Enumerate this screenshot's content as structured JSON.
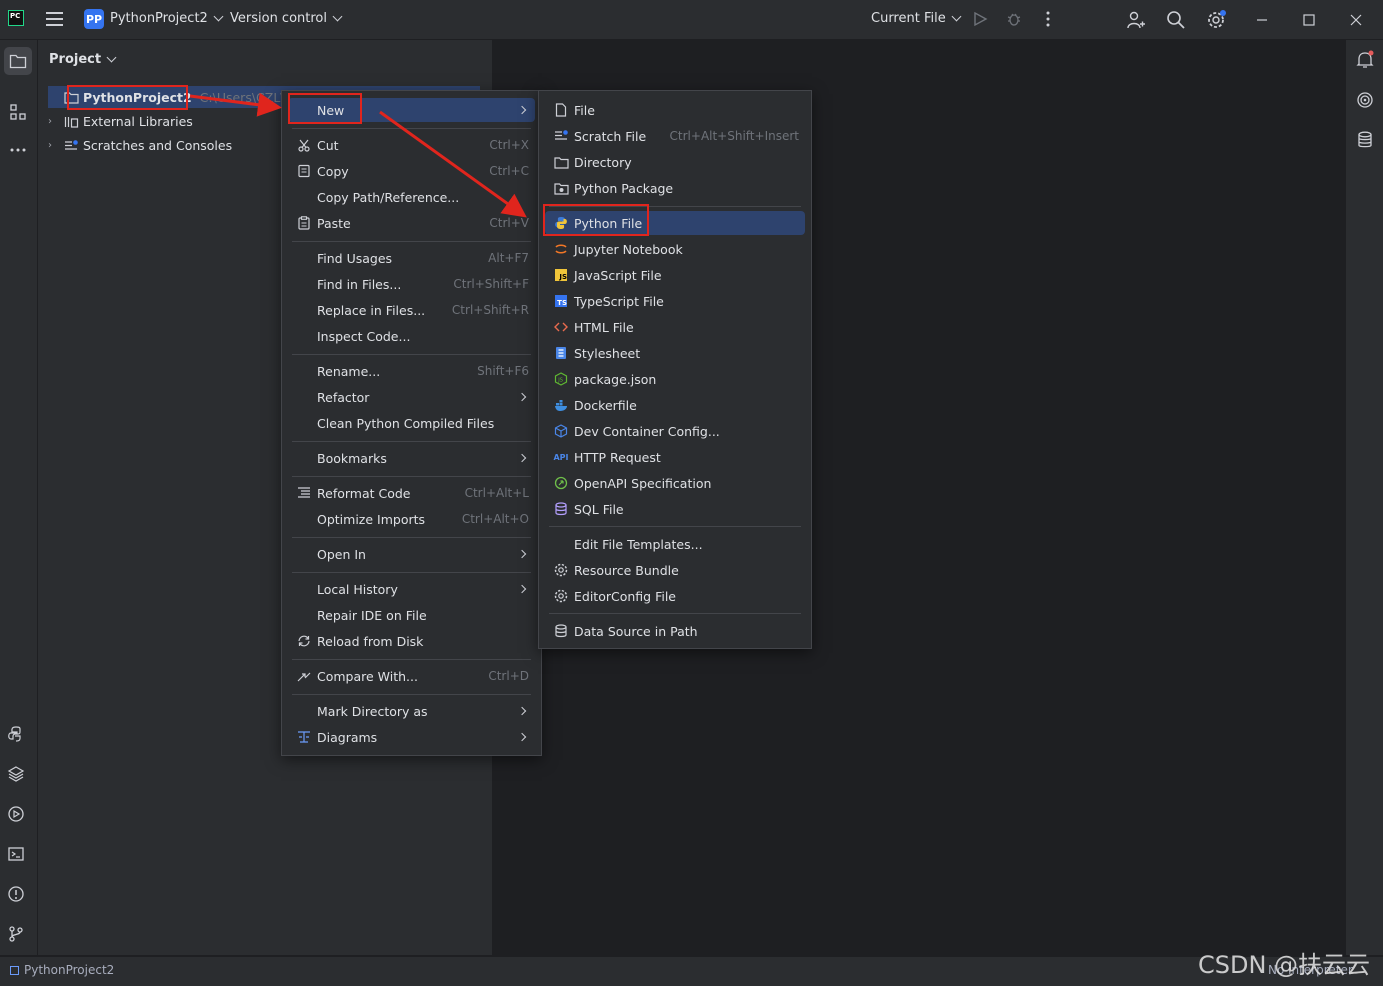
{
  "titlebar": {
    "logo_text": "PC",
    "project_badge": "PP",
    "project_name": "PythonProject2",
    "vcs": "Version control",
    "run_config": "Current File"
  },
  "project_panel": {
    "header": "Project",
    "tree": [
      {
        "label": "PythonProject2",
        "path": "C:\\Users\\CZL\\Py"
      },
      {
        "label": "External Libraries"
      },
      {
        "label": "Scratches and Consoles"
      }
    ]
  },
  "context_menu": {
    "items": [
      {
        "label": "New",
        "shortcut": "",
        "submenu": true
      },
      {
        "label": "Cut",
        "shortcut": "Ctrl+X"
      },
      {
        "label": "Copy",
        "shortcut": "Ctrl+C"
      },
      {
        "label": "Copy Path/Reference...",
        "shortcut": ""
      },
      {
        "label": "Paste",
        "shortcut": "Ctrl+V"
      },
      {
        "label": "Find Usages",
        "shortcut": "Alt+F7"
      },
      {
        "label": "Find in Files...",
        "shortcut": "Ctrl+Shift+F"
      },
      {
        "label": "Replace in Files...",
        "shortcut": "Ctrl+Shift+R"
      },
      {
        "label": "Inspect Code...",
        "shortcut": ""
      },
      {
        "label": "Rename...",
        "shortcut": "Shift+F6"
      },
      {
        "label": "Refactor",
        "shortcut": "",
        "submenu": true
      },
      {
        "label": "Clean Python Compiled Files",
        "shortcut": ""
      },
      {
        "label": "Bookmarks",
        "shortcut": "",
        "submenu": true
      },
      {
        "label": "Reformat Code",
        "shortcut": "Ctrl+Alt+L"
      },
      {
        "label": "Optimize Imports",
        "shortcut": "Ctrl+Alt+O"
      },
      {
        "label": "Open In",
        "shortcut": "",
        "submenu": true
      },
      {
        "label": "Local History",
        "shortcut": "",
        "submenu": true
      },
      {
        "label": "Repair IDE on File",
        "shortcut": ""
      },
      {
        "label": "Reload from Disk",
        "shortcut": ""
      },
      {
        "label": "Compare With...",
        "shortcut": "Ctrl+D"
      },
      {
        "label": "Mark Directory as",
        "shortcut": "",
        "submenu": true
      },
      {
        "label": "Diagrams",
        "shortcut": "",
        "submenu": true
      }
    ]
  },
  "new_submenu": {
    "items": [
      {
        "label": "File",
        "shortcut": ""
      },
      {
        "label": "Scratch File",
        "shortcut": "Ctrl+Alt+Shift+Insert"
      },
      {
        "label": "Directory",
        "shortcut": ""
      },
      {
        "label": "Python Package",
        "shortcut": ""
      },
      {
        "label": "Python File",
        "shortcut": ""
      },
      {
        "label": "Jupyter Notebook",
        "shortcut": ""
      },
      {
        "label": "JavaScript File",
        "shortcut": ""
      },
      {
        "label": "TypeScript File",
        "shortcut": ""
      },
      {
        "label": "HTML File",
        "shortcut": ""
      },
      {
        "label": "Stylesheet",
        "shortcut": ""
      },
      {
        "label": "package.json",
        "shortcut": ""
      },
      {
        "label": "Dockerfile",
        "shortcut": ""
      },
      {
        "label": "Dev Container Config...",
        "shortcut": ""
      },
      {
        "label": "HTTP Request",
        "shortcut": ""
      },
      {
        "label": "OpenAPI Specification",
        "shortcut": ""
      },
      {
        "label": "SQL File",
        "shortcut": ""
      },
      {
        "label": "Edit File Templates...",
        "shortcut": ""
      },
      {
        "label": "Resource Bundle",
        "shortcut": ""
      },
      {
        "label": "EditorConfig File",
        "shortcut": ""
      },
      {
        "label": "Data Source in Path",
        "shortcut": ""
      }
    ],
    "icon_texts": {
      "js": "JS",
      "ts": "TS",
      "api": "API"
    }
  },
  "statusbar": {
    "project": "PythonProject2",
    "interpreter": "No interpreter"
  },
  "watermark": "CSDN @扶云云",
  "colors": {
    "accent": "#3574f0",
    "selection": "#2e436e",
    "annotation_red": "#e0251d"
  }
}
